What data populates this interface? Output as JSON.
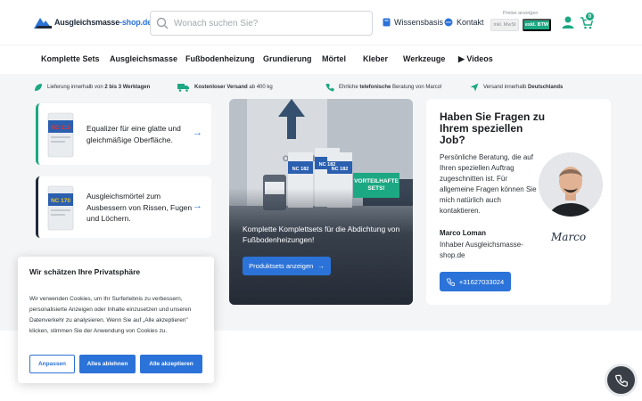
{
  "header": {
    "logo": {
      "main": "Ausgleichsmasse",
      "accent": "-shop.de"
    },
    "search": {
      "placeholder": "Wonach suchen Sie?"
    },
    "links": [
      {
        "label": "Wissensbasis",
        "icon": "book-icon"
      },
      {
        "label": "Kontakt",
        "icon": "chat-icon"
      }
    ],
    "price_toggle": {
      "label": "Preise anzeigen",
      "incl": "inkl. MwSt",
      "excl": "exkl. BTW"
    },
    "cart_count": "0"
  },
  "nav": {
    "items": [
      "Komplette Sets",
      "Ausgleichsmasse",
      "Fußbodenheizung",
      "Grundierung",
      "Mörtel",
      "Kleber",
      "Werkzeuge",
      "▶ Videos"
    ]
  },
  "usps": [
    {
      "pre": "Lieferung innerhalb von ",
      "bold": "2 bis 3 Werktagen",
      "post": ""
    },
    {
      "pre": "",
      "bold": "Kostenloser Versand",
      "post": " ab 400 kg"
    },
    {
      "pre": "Ehrliche ",
      "bold": "telefonische",
      "post": " Beratung von Marco!"
    },
    {
      "pre": "Versand innerhalb ",
      "bold": "Deutschlands",
      "post": ""
    }
  ],
  "product_cards": [
    {
      "text": "Equalizer für eine glatte und gleichmäßige Oberfläche.",
      "bag_label": "NC 115"
    },
    {
      "text": "Ausgleichsmörtel zum Ausbessern von Rissen, Fugen und Löchern.",
      "bag_label": "NC 170"
    }
  ],
  "hero": {
    "badge": "VORTEILHAFTE SETS!",
    "text": "Komplette Komplettsets für die Abdichtung von Fußbodenheizungen!",
    "button": "Produktsets anzeigen",
    "bag_label": "NC 182"
  },
  "contact": {
    "title": "Haben Sie Fragen zu Ihrem speziellen Job?",
    "text": "Persönliche Beratung, die auf Ihren speziellen Auftrag zugeschnitten ist. Für allgemeine Fragen können Sie mich natürlich auch kontaktieren.",
    "name": "Marco Loman",
    "role": "Inhaber Ausgleichsmasse-shop.de",
    "signature": "Marco",
    "phone": "+31627033024"
  },
  "cookie": {
    "title": "Wir schätzen Ihre Privatsphäre",
    "text": "Wir verwenden Cookies, um Ihr Surferlebnis zu verbessern, personalisierte Anzeigen oder Inhalte einzusetzen und unseren Datenverkehr zu analysieren. Wenn Sie auf „Alle akzeptieren\" klicken, stimmen Sie der Anwendung von Cookies zu.",
    "buttons": {
      "customize": "Anpassen",
      "reject": "Alles ablehnen",
      "accept": "Alle akzeptieren"
    }
  },
  "colors": {
    "brand_blue": "#2b73d8",
    "accent_green": "#1ca882",
    "dark_navy": "#1e2a3a"
  }
}
